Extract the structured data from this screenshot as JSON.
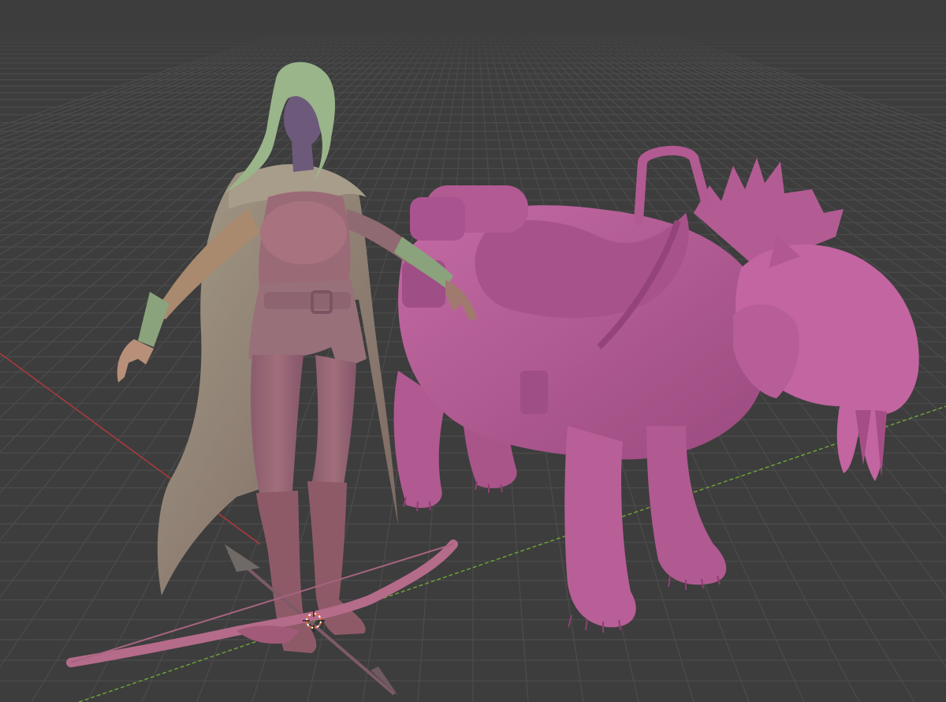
{
  "viewport": {
    "background_color": "#3d3d3d",
    "grid_color": "#4b4b4b",
    "x_axis_color": "#b03a3a",
    "y_axis_color": "#6da036"
  },
  "scene": {
    "objects": [
      {
        "name": "hair",
        "color": "#9ab58a"
      },
      {
        "name": "skin",
        "color": "#6d5a7a"
      },
      {
        "name": "cloak",
        "color": "#8f7a6f"
      },
      {
        "name": "gloves",
        "color": "#8aa37c"
      },
      {
        "name": "body",
        "color": "#936572"
      },
      {
        "name": "boots",
        "color": "#8f5a68"
      },
      {
        "name": "bow",
        "color": "#b56b8a"
      },
      {
        "name": "arrow",
        "color": "#7d5a68"
      },
      {
        "name": "lion",
        "color": "#b35c93"
      },
      {
        "name": "saddle",
        "color": "#a8528a"
      }
    ],
    "origin_marker": {
      "icon": "crosshair-icon",
      "color": "#e06a3a"
    }
  }
}
